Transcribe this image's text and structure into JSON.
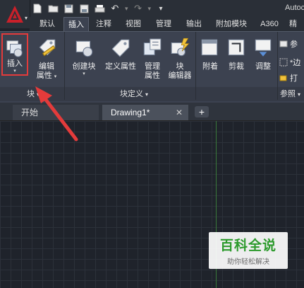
{
  "app": {
    "title": "Autoc"
  },
  "quick_access": {
    "icons": [
      "new-file-icon",
      "open-folder-icon",
      "save-icon",
      "save-as-icon",
      "print-icon",
      "undo-icon",
      "redo-icon",
      "workspace-dropdown-icon"
    ]
  },
  "ribbon_tabs": [
    "默认",
    "插入",
    "注释",
    "视图",
    "管理",
    "输出",
    "附加模块",
    "A360",
    "精"
  ],
  "active_tab": "插入",
  "ribbon": {
    "insert": {
      "label": "插入"
    },
    "edit_attr": {
      "line1": "编辑",
      "line2": "属性"
    },
    "create_block": {
      "label": "创建块"
    },
    "define_attr": {
      "label": "定义属性"
    },
    "manage_attr": {
      "line1": "管理",
      "line2": "属性"
    },
    "block_editor": {
      "line1": "块",
      "line2": "编辑器"
    },
    "attach": {
      "label": "附着"
    },
    "clip": {
      "label": "剪裁"
    },
    "adjust": {
      "label": "调整"
    },
    "side_items": [
      "参",
      "*边",
      "打"
    ],
    "panels": {
      "block": "块",
      "block_def": "块定义",
      "reference": "参照"
    }
  },
  "doc_tabs": {
    "start": "开始",
    "drawing": "Drawing1*",
    "close": "✕",
    "new": "+"
  },
  "watermark": {
    "title": "百科全说",
    "subtitle": "助你轻松解决"
  },
  "colors": {
    "highlight": "#e33b3b",
    "watermark_green": "#2c9a2c"
  }
}
